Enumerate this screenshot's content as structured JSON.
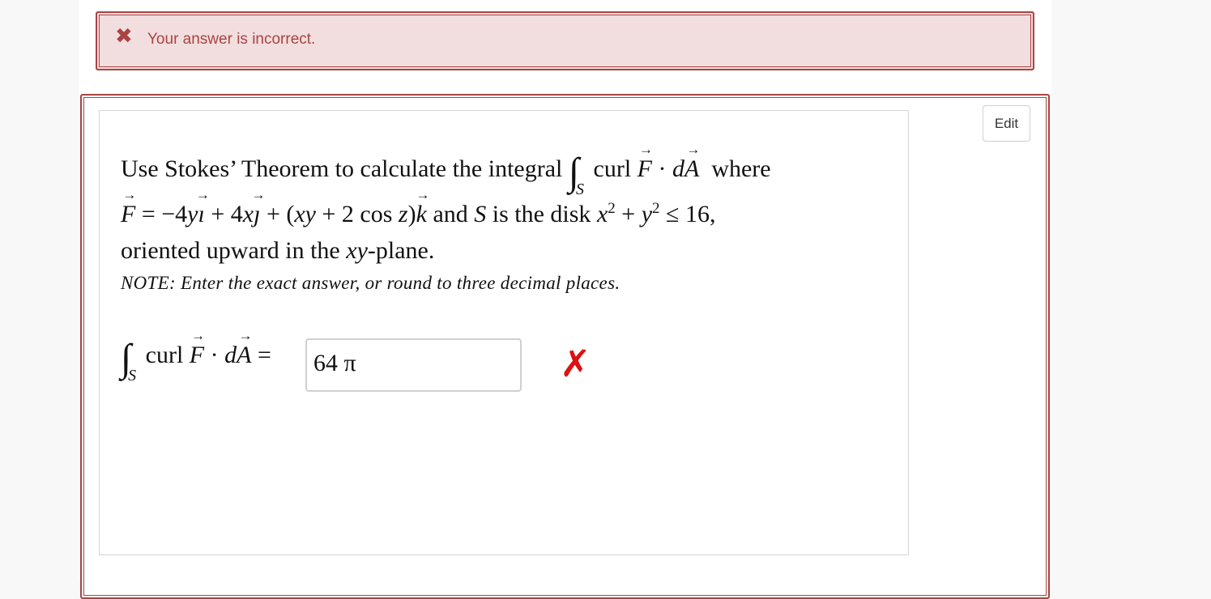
{
  "alert": {
    "icon": "x-icon",
    "glyph": "✖",
    "message": "Your answer is incorrect."
  },
  "toolbar": {
    "edit_label": "Edit"
  },
  "question": {
    "intro": "Use Stokes’ Theorem to calculate the integral",
    "curl": "curl",
    "where": "where",
    "field_rest": "and",
    "surface_sym": "S",
    "disk_text": "is the disk",
    "line3": "oriented upward in the",
    "plane_suffix": "-plane.",
    "note": "NOTE: Enter the exact answer, or round to three decimal places."
  },
  "answer": {
    "value": "64 π",
    "status_icon": "wrong-icon",
    "status_glyph": "✗"
  },
  "colors": {
    "alert_border": "#a94442",
    "alert_bg": "#f2dede",
    "wrong": "#dd1111"
  }
}
